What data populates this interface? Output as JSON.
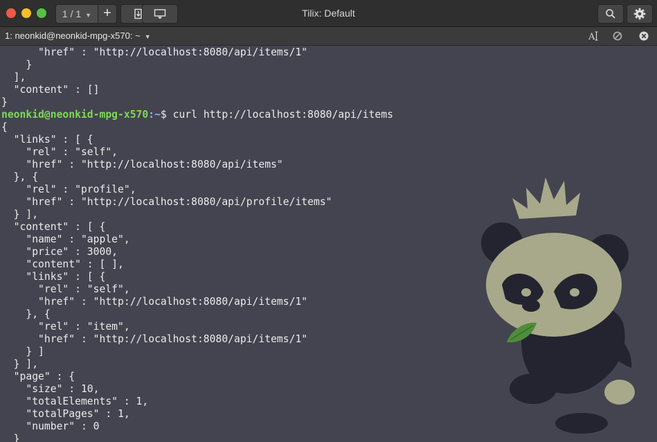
{
  "window": {
    "title": "Tilix: Default",
    "session_counter": "1 / 1",
    "icons": [
      "close",
      "minimize",
      "maximize",
      "add-session",
      "attach-file",
      "sync-input",
      "search",
      "settings"
    ]
  },
  "terminal": {
    "title": "1: neonkid@neonkid-mpg-x570: ~",
    "header_icons": [
      "font-size-icon",
      "read-only-icon",
      "close-icon"
    ],
    "prompt": {
      "user_host": "neonkid@neonkid-mpg-x570",
      "path": ":~",
      "symbol": "$ ",
      "command": "curl http://localhost:8080/api/items"
    },
    "before_prompt": [
      "      \"href\" : \"http://localhost:8080/api/items/1\"",
      "    }",
      "  ],",
      "  \"content\" : []",
      "}"
    ],
    "after_prompt": [
      "{",
      "  \"links\" : [ {",
      "    \"rel\" : \"self\",",
      "    \"href\" : \"http://localhost:8080/api/items\"",
      "  }, {",
      "    \"rel\" : \"profile\",",
      "    \"href\" : \"http://localhost:8080/api/profile/items\"",
      "  } ],",
      "  \"content\" : [ {",
      "    \"name\" : \"apple\",",
      "    \"price\" : 3000,",
      "    \"content\" : [ ],",
      "    \"links\" : [ {",
      "      \"rel\" : \"self\",",
      "      \"href\" : \"http://localhost:8080/api/items/1\"",
      "    }, {",
      "      \"rel\" : \"item\",",
      "      \"href\" : \"http://localhost:8080/api/items/1\"",
      "    } ]",
      "  } ],",
      "  \"page\" : {",
      "    \"size\" : 10,",
      "    \"totalElements\" : 1,",
      "    \"totalPages\" : 1,",
      "    \"number\" : 0",
      "  }"
    ],
    "colors": {
      "background": "#43444f",
      "foreground": "#ebebeb",
      "prompt_user": "#7ed957",
      "prompt_path": "#8ab4f8"
    }
  }
}
